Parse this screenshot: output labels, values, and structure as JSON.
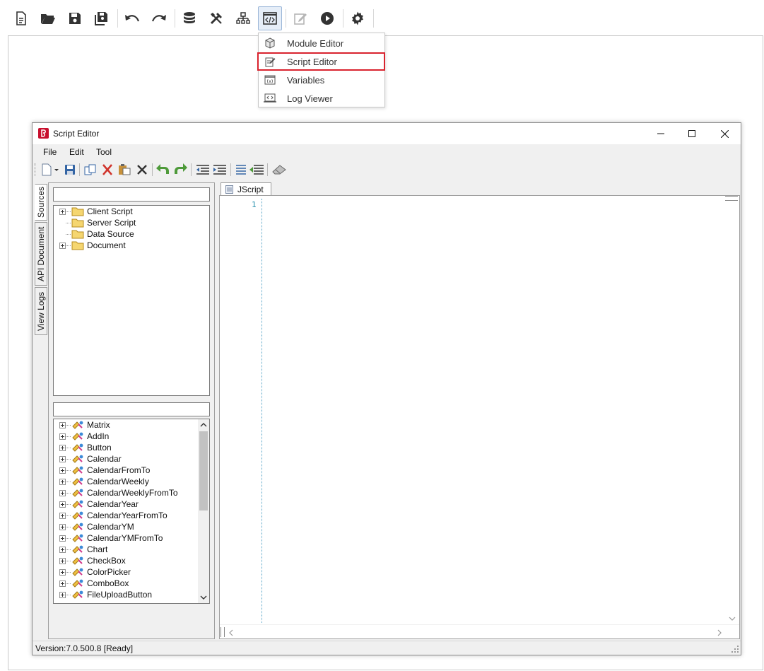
{
  "toolbar": {
    "buttons": [
      {
        "id": "new",
        "icon": "document-icon"
      },
      {
        "id": "open",
        "icon": "folder-open-icon"
      },
      {
        "id": "save",
        "icon": "save-icon"
      },
      {
        "id": "save-all",
        "icon": "save-all-icon"
      },
      {
        "id": "undo",
        "icon": "undo-icon"
      },
      {
        "id": "redo",
        "icon": "redo-icon"
      },
      {
        "id": "database",
        "icon": "database-icon"
      },
      {
        "id": "tools",
        "icon": "tools-icon"
      },
      {
        "id": "hierarchy",
        "icon": "hierarchy-icon"
      },
      {
        "id": "code-window",
        "icon": "code-window-icon"
      },
      {
        "id": "edit",
        "icon": "edit-icon"
      },
      {
        "id": "run",
        "icon": "play-icon"
      },
      {
        "id": "settings",
        "icon": "gear-icon"
      }
    ]
  },
  "dropdown": {
    "items": [
      {
        "label": "Module Editor",
        "icon": "module-icon"
      },
      {
        "label": "Script Editor",
        "icon": "script-editor-icon"
      },
      {
        "label": "Variables",
        "icon": "variables-icon"
      },
      {
        "label": "Log Viewer",
        "icon": "log-viewer-icon"
      }
    ]
  },
  "window": {
    "title": "Script Editor",
    "menu": [
      "File",
      "Edit",
      "Tool"
    ],
    "vertical_tabs": [
      "Sources",
      "API Document",
      "View Logs"
    ],
    "sources_tree": [
      "Client Script",
      "Server Script",
      "Data Source",
      "Document"
    ],
    "components_tree": [
      "Matrix",
      "AddIn",
      "Button",
      "Calendar",
      "CalendarFromTo",
      "CalendarWeekly",
      "CalendarWeeklyFromTo",
      "CalendarYear",
      "CalendarYearFromTo",
      "CalendarYM",
      "CalendarYMFromTo",
      "Chart",
      "CheckBox",
      "ColorPicker",
      "ComboBox",
      "FileUploadButton"
    ],
    "doc_tab": "JScript",
    "line_number": "1",
    "status": "Version:7.0.500.8  [Ready]"
  },
  "colors": {
    "highlight_border": "#d9232e",
    "line_number": "#2b91af",
    "app_icon": "#c8102e"
  }
}
